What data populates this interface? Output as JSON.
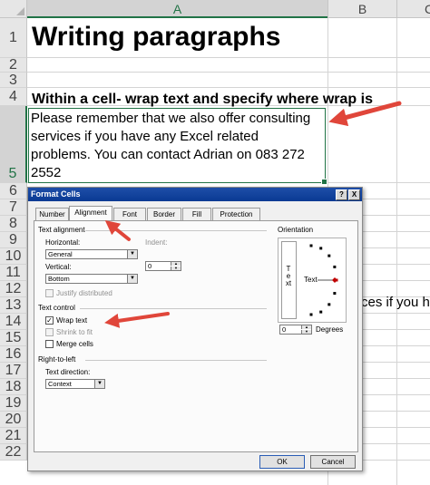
{
  "columns": [
    "A",
    "B",
    "C"
  ],
  "rows": [
    "1",
    "2",
    "3",
    "4",
    "5",
    "6",
    "7",
    "8",
    "9",
    "10",
    "11",
    "12",
    "13",
    "14",
    "15",
    "16",
    "17",
    "18",
    "19",
    "20",
    "21",
    "22"
  ],
  "cells": {
    "title": "Writing paragraphs",
    "subheading": "Within a cell- wrap text and specify where wrap is",
    "wrapped_lines": [
      "Please remember that we also offer consulting",
      "services if you have any Excel related",
      "problems. You can contact Adrian on 083 272",
      "2552"
    ],
    "overflow_text": "ces if you h"
  },
  "dialog": {
    "title": "Format Cells",
    "title_buttons": [
      "?",
      "X"
    ],
    "tabs": [
      "Number",
      "Alignment",
      "Font",
      "Border",
      "Fill",
      "Protection"
    ],
    "active_tab": "Alignment",
    "text_alignment": {
      "heading": "Text alignment",
      "horizontal_label": "Horizontal:",
      "horizontal_value": "General",
      "indent_label": "Indent:",
      "indent_value": "0",
      "vertical_label": "Vertical:",
      "vertical_value": "Bottom",
      "justify_distributed": "Justify distributed"
    },
    "text_control": {
      "heading": "Text control",
      "wrap_text": "Wrap text",
      "wrap_checked": true,
      "shrink_to_fit": "Shrink to fit",
      "merge_cells": "Merge cells"
    },
    "right_to_left": {
      "heading": "Right-to-left",
      "direction_label": "Text direction:",
      "direction_value": "Context"
    },
    "orientation": {
      "heading": "Orientation",
      "vertical_text": "Text",
      "horizontal_text": "Text",
      "degrees_value": "0",
      "degrees_label": "Degrees"
    },
    "buttons": {
      "ok": "OK",
      "cancel": "Cancel"
    }
  },
  "colors": {
    "excel_green": "#217346",
    "arrow": "#e0463a",
    "titlebar": "#0a3a93"
  }
}
